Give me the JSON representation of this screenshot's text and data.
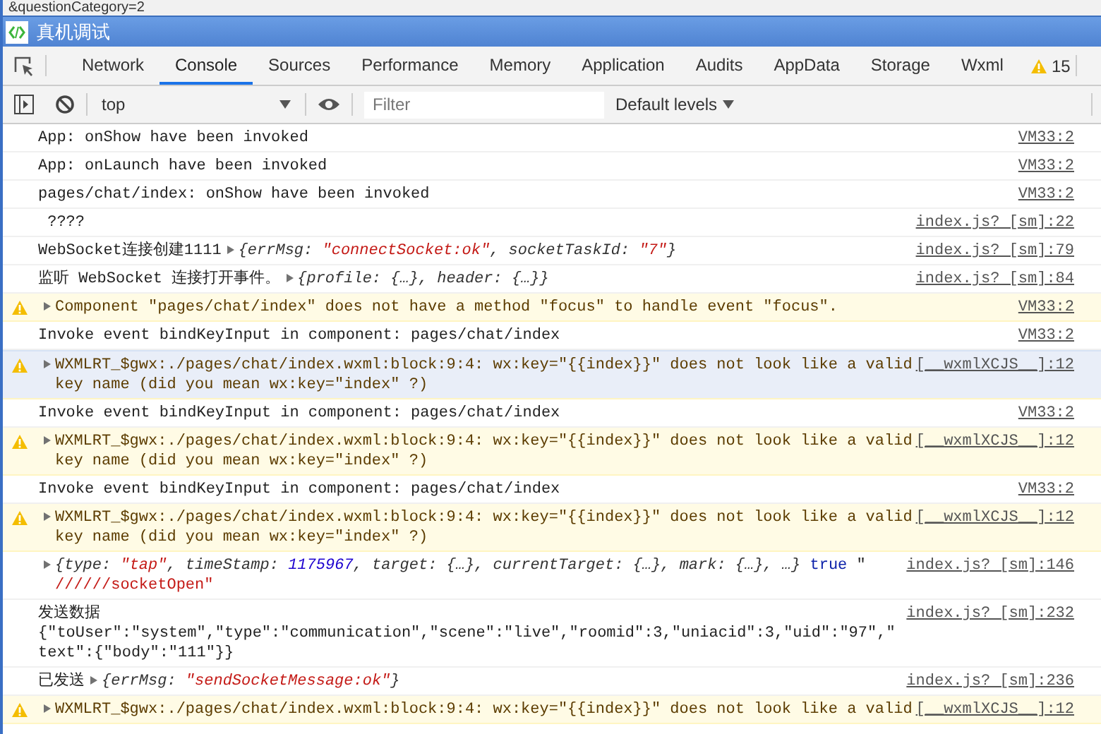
{
  "page_behind": {
    "url_fragment": "&questionCategory=2"
  },
  "window": {
    "title": "真机调试"
  },
  "tabs": [
    {
      "label": "Network",
      "selected": false
    },
    {
      "label": "Console",
      "selected": true
    },
    {
      "label": "Sources",
      "selected": false
    },
    {
      "label": "Performance",
      "selected": false
    },
    {
      "label": "Memory",
      "selected": false
    },
    {
      "label": "Application",
      "selected": false
    },
    {
      "label": "Audits",
      "selected": false
    },
    {
      "label": "AppData",
      "selected": false
    },
    {
      "label": "Storage",
      "selected": false
    },
    {
      "label": "Wxml",
      "selected": false
    }
  ],
  "warning_count": "15",
  "toolbar": {
    "context": "top",
    "filter": {
      "placeholder": "Filter"
    },
    "levels": "Default levels"
  },
  "entries": [
    {
      "kind": "log",
      "selected": false,
      "parts": [
        {
          "kind": "text",
          "text": "App: onShow have been invoked"
        }
      ],
      "source": "VM33:2"
    },
    {
      "kind": "log",
      "selected": false,
      "parts": [
        {
          "kind": "text",
          "text": "App: onLaunch have been invoked"
        }
      ],
      "source": "VM33:2"
    },
    {
      "kind": "log",
      "selected": false,
      "parts": [
        {
          "kind": "text",
          "text": "pages/chat/index: onShow have been invoked"
        }
      ],
      "source": "VM33:2"
    },
    {
      "kind": "log",
      "selected": false,
      "parts": [
        {
          "kind": "text",
          "text": " ????"
        }
      ],
      "source": "index.js? [sm]:22"
    },
    {
      "kind": "log",
      "selected": false,
      "parts": [
        {
          "kind": "text",
          "text": "WebSocket连接创建1111"
        },
        {
          "kind": "toggle",
          "expanded": false
        },
        {
          "kind": "preview",
          "segments": [
            {
              "kind": "punct",
              "text": "{errMsg: "
            },
            {
              "kind": "string",
              "text": "\"connectSocket:ok\""
            },
            {
              "kind": "punct",
              "text": ", socketTaskId: "
            },
            {
              "kind": "string",
              "text": "\"7\""
            },
            {
              "kind": "punct",
              "text": "}"
            }
          ]
        }
      ],
      "source": "index.js? [sm]:79"
    },
    {
      "kind": "log",
      "selected": false,
      "parts": [
        {
          "kind": "text",
          "text": "监听 WebSocket 连接打开事件。"
        },
        {
          "kind": "toggle",
          "expanded": false
        },
        {
          "kind": "preview",
          "segments": [
            {
              "kind": "punct",
              "text": "{profile: {…}, header: {…}}"
            }
          ]
        }
      ],
      "source": "index.js? [sm]:84"
    },
    {
      "kind": "warning",
      "selected": false,
      "parts": [
        {
          "kind": "toggle",
          "expanded": false
        },
        {
          "kind": "text",
          "text": "Component \"pages/chat/index\" does not have a method \"focus\" to handle event \"focus\"."
        }
      ],
      "source": "VM33:2"
    },
    {
      "kind": "log",
      "selected": false,
      "parts": [
        {
          "kind": "text",
          "text": "Invoke event bindKeyInput in component: pages/chat/index"
        }
      ],
      "source": "VM33:2"
    },
    {
      "kind": "warning",
      "selected": true,
      "parts": [
        {
          "kind": "toggle",
          "expanded": false
        },
        {
          "kind": "text",
          "text": "WXMLRT_$gwx:./pages/chat/index.wxml:block:9:4: wx:key=\"{{index}}\" does not look like a valid key name (did you mean wx:key=\"index\" ?)"
        }
      ],
      "source": "[__wxmlXCJS__]:12"
    },
    {
      "kind": "log",
      "selected": false,
      "parts": [
        {
          "kind": "text",
          "text": "Invoke event bindKeyInput in component: pages/chat/index"
        }
      ],
      "source": "VM33:2"
    },
    {
      "kind": "warning",
      "selected": false,
      "parts": [
        {
          "kind": "toggle",
          "expanded": false
        },
        {
          "kind": "text",
          "text": "WXMLRT_$gwx:./pages/chat/index.wxml:block:9:4: wx:key=\"{{index}}\" does not look like a valid key name (did you mean wx:key=\"index\" ?)"
        }
      ],
      "source": "[__wxmlXCJS__]:12"
    },
    {
      "kind": "log",
      "selected": false,
      "parts": [
        {
          "kind": "text",
          "text": "Invoke event bindKeyInput in component: pages/chat/index"
        }
      ],
      "source": "VM33:2"
    },
    {
      "kind": "warning",
      "selected": false,
      "parts": [
        {
          "kind": "toggle",
          "expanded": false
        },
        {
          "kind": "text",
          "text": "WXMLRT_$gwx:./pages/chat/index.wxml:block:9:4: wx:key=\"{{index}}\" does not look like a valid key name (did you mean wx:key=\"index\" ?)"
        }
      ],
      "source": "[__wxmlXCJS__]:12"
    },
    {
      "kind": "log",
      "selected": false,
      "parts": [
        {
          "kind": "toggle",
          "expanded": false
        },
        {
          "kind": "preview",
          "segments": [
            {
              "kind": "punct",
              "text": "{type: "
            },
            {
              "kind": "string",
              "text": "\"tap\""
            },
            {
              "kind": "punct",
              "text": ", timeStamp: "
            },
            {
              "kind": "number",
              "text": "1175967"
            },
            {
              "kind": "punct",
              "text": ", target: {…}, currentTarget: {…}, mark: {…}, …}"
            },
            {
              "kind": "keyword",
              "text": " true"
            },
            {
              "kind": "plain",
              "text": " \"\n"
            },
            {
              "kind": "raw-string",
              "text": "//////socketOpen\""
            }
          ]
        }
      ],
      "source": "index.js? [sm]:146"
    },
    {
      "kind": "log",
      "selected": false,
      "parts": [
        {
          "kind": "text",
          "text": "发送数据\n{\"toUser\":\"system\",\"type\":\"communication\",\"scene\":\"live\",\"roomid\":3,\"uniacid\":3,\"uid\":\"97\",\"text\":{\"body\":\"111\"}}"
        }
      ],
      "source": "index.js? [sm]:232"
    },
    {
      "kind": "log",
      "selected": false,
      "parts": [
        {
          "kind": "text",
          "text": "已发送"
        },
        {
          "kind": "toggle",
          "expanded": false
        },
        {
          "kind": "preview",
          "segments": [
            {
              "kind": "punct",
              "text": "{errMsg: "
            },
            {
              "kind": "string",
              "text": "\"sendSocketMessage:ok\""
            },
            {
              "kind": "punct",
              "text": "}"
            }
          ]
        }
      ],
      "source": "index.js? [sm]:236"
    },
    {
      "kind": "warning",
      "selected": false,
      "parts": [
        {
          "kind": "toggle",
          "expanded": false
        },
        {
          "kind": "text",
          "text": "WXMLRT_$gwx:./pages/chat/index.wxml:block:9:4: wx:key=\"{{index}}\" does not look like a valid"
        }
      ],
      "source": "[__wxmlXCJS__]:12"
    }
  ]
}
